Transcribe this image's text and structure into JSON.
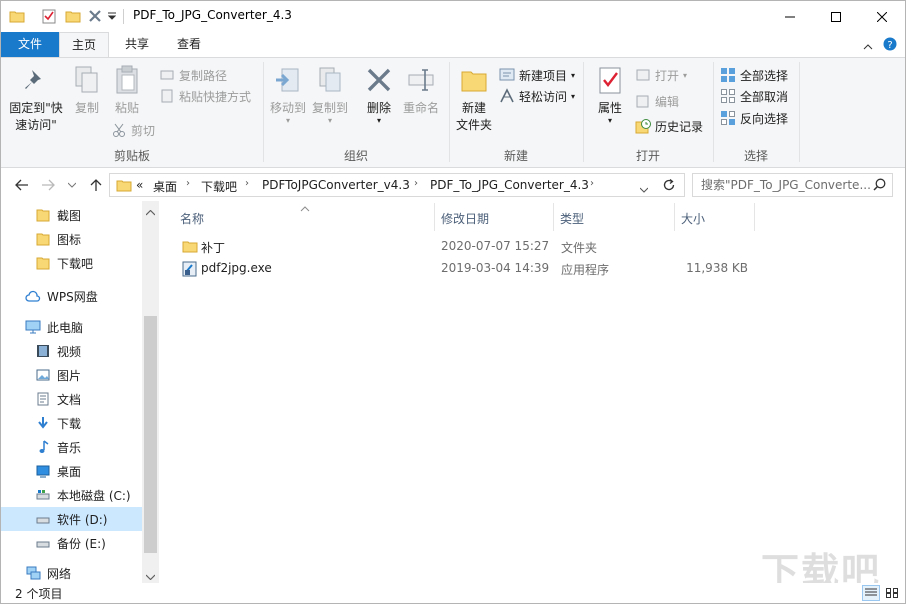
{
  "window": {
    "title": "PDF_To_JPG_Converter_4.3"
  },
  "tabs": {
    "file": "文件",
    "home": "主页",
    "share": "共享",
    "view": "查看"
  },
  "ribbon": {
    "clipboard": {
      "label": "剪贴板",
      "pin_line1": "固定到\"快",
      "pin_line2": "速访问\"",
      "copy": "复制",
      "paste": "粘贴",
      "copy_path": "复制路径",
      "paste_shortcut": "粘贴快捷方式",
      "cut": "剪切"
    },
    "organize": {
      "label": "组织",
      "move_to": "移动到",
      "copy_to": "复制到",
      "delete": "删除",
      "rename": "重命名"
    },
    "new": {
      "label": "新建",
      "new_folder_line1": "新建",
      "new_folder_line2": "文件夹",
      "new_item": "新建项目",
      "easy_access": "轻松访问"
    },
    "open": {
      "label": "打开",
      "properties": "属性",
      "open": "打开",
      "edit": "编辑",
      "history": "历史记录"
    },
    "select": {
      "label": "选择",
      "select_all": "全部选择",
      "select_none": "全部取消",
      "invert": "反向选择"
    }
  },
  "address": {
    "overflow": "«",
    "crumbs": [
      "桌面",
      "下载吧",
      "PDFToJPGConverter_v4.3",
      "PDF_To_JPG_Converter_4.3"
    ]
  },
  "search": {
    "placeholder": "搜索\"PDF_To_JPG_Converte..."
  },
  "sidebar": {
    "items": [
      {
        "label": "截图",
        "icon": "folder-icon"
      },
      {
        "label": "图标",
        "icon": "folder-icon"
      },
      {
        "label": "下载吧",
        "icon": "folder-icon"
      },
      {
        "label": "WPS网盘",
        "icon": "cloud-icon"
      },
      {
        "label": "此电脑",
        "icon": "computer-icon"
      },
      {
        "label": "视频",
        "icon": "video-icon"
      },
      {
        "label": "图片",
        "icon": "picture-icon"
      },
      {
        "label": "文档",
        "icon": "document-icon"
      },
      {
        "label": "下载",
        "icon": "download-icon"
      },
      {
        "label": "音乐",
        "icon": "music-icon"
      },
      {
        "label": "桌面",
        "icon": "desktop-icon"
      },
      {
        "label": "本地磁盘 (C:)",
        "icon": "drive-icon"
      },
      {
        "label": "软件 (D:)",
        "icon": "drive-icon",
        "selected": true
      },
      {
        "label": "备份 (E:)",
        "icon": "drive-icon"
      },
      {
        "label": "网络",
        "icon": "network-icon"
      }
    ]
  },
  "columns": {
    "name": "名称",
    "modified": "修改日期",
    "type": "类型",
    "size": "大小"
  },
  "files": [
    {
      "name": "补丁",
      "modified": "2020-07-07 15:27",
      "type": "文件夹",
      "size": "",
      "icon": "folder-icon"
    },
    {
      "name": "pdf2jpg.exe",
      "modified": "2019-03-04 14:39",
      "type": "应用程序",
      "size": "11,938 KB",
      "icon": "exe-icon"
    }
  ],
  "status": {
    "count": "2 个项目"
  },
  "watermark": "下载吧",
  "colors": {
    "accent": "#1979ca",
    "selected": "#cce8ff",
    "folder": "#f8d775"
  }
}
